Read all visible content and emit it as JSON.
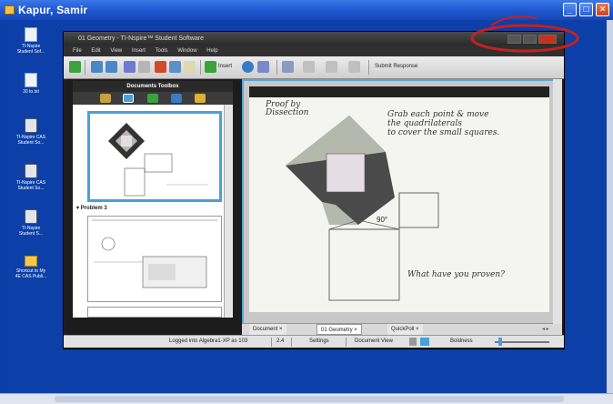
{
  "remote": {
    "title": "Kapur, Samir"
  },
  "desktop": {
    "icons": [
      {
        "name": "doc-icon",
        "label1": "TI-Nspire",
        "label2": "Student Sof..."
      },
      {
        "name": "text-icon",
        "label1": "30 to.txt",
        "label2": ""
      },
      {
        "name": "calc-icon",
        "label1": "TI-Nspire CAS",
        "label2": "Student So..."
      },
      {
        "name": "calc-icon",
        "label1": "TI-Nspire CAS",
        "label2": "Student So..."
      },
      {
        "name": "calc-icon",
        "label1": "TI-Nspire",
        "label2": "Student S..."
      },
      {
        "name": "folder-icon",
        "label1": "Shortcut to My",
        "label2": "4E CAS Publi..."
      }
    ]
  },
  "app": {
    "title": "01 Geometry - TI-Nspire™ Student Software",
    "menu": [
      "File",
      "Edit",
      "View",
      "Insert",
      "Tools",
      "Window",
      "Help"
    ],
    "toolbar": {
      "insert_label": "Insert",
      "submit_label": "Submit Response"
    },
    "toolbox": {
      "header": "Documents Toolbox",
      "problem_label": "Problem 3"
    },
    "page": {
      "proof_line1": "Proof by",
      "proof_line2": "Dissection",
      "instr_line1": "Grab each point & move",
      "instr_line2": "the quadrilaterals",
      "instr_line3": "to cover the small squares.",
      "angle": "90°",
      "question": "What have you proven?"
    },
    "doc_tabs": [
      "Document",
      "01 Geometry",
      "QuickPoll"
    ],
    "status": {
      "logged": "Logged into Algebra1-XP as 103",
      "page_no": "2.4",
      "settings": "Settings",
      "view": "Document View",
      "boldness": "Boldness"
    }
  },
  "colors": {
    "desktop_blue": "#0c3fa8",
    "titlebar_blue": "#2a5fd6",
    "highlight_red": "#c81f1f",
    "frame_blue": "#5aa7d8",
    "dark_gray": "#4a4a4a",
    "mid_gray": "#b4b8ad",
    "light_square": "#e6dde3"
  }
}
